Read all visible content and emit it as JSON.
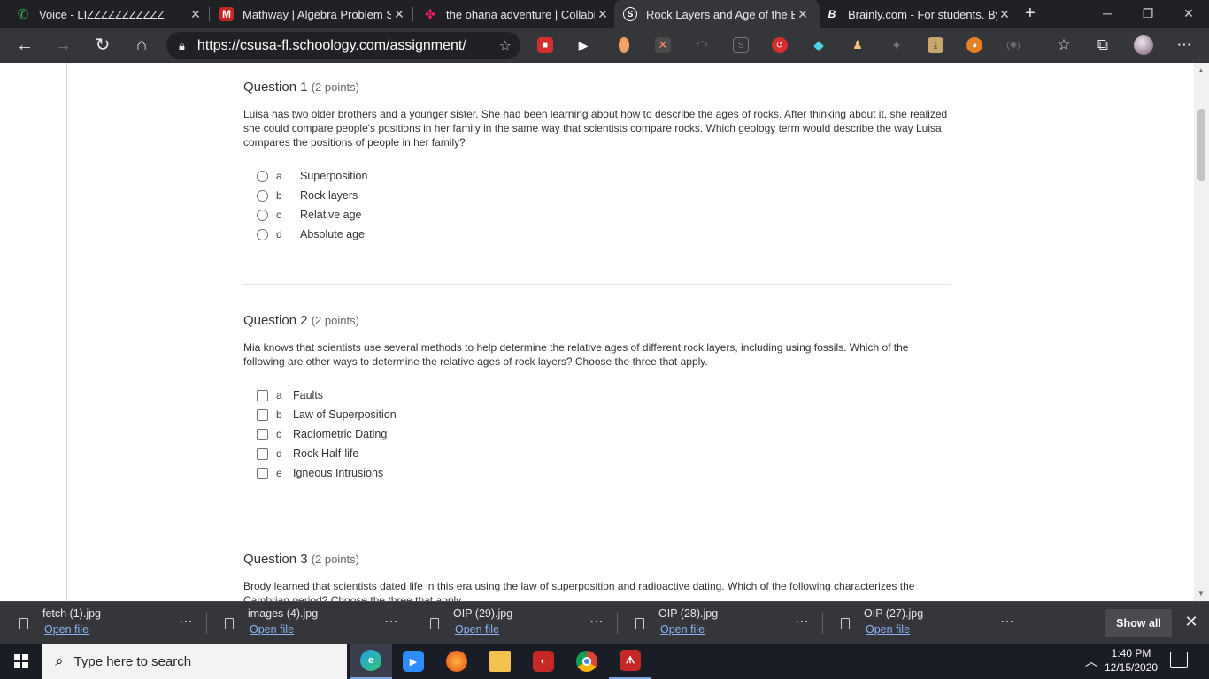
{
  "browser": {
    "tabs": [
      {
        "title": "Voice - LIZZZZZZZZZZZ",
        "icon": "phone-icon",
        "color": "#34a853"
      },
      {
        "title": "Mathway | Algebra Problem Solver",
        "icon": "mathway-icon",
        "color": "#c62828"
      },
      {
        "title": "the ohana adventure | Collabify",
        "icon": "collabify-icon",
        "color": "#e91e63"
      },
      {
        "title": "Rock Layers and Age of the Earth",
        "icon": "schoology-icon",
        "color": "#ffffff",
        "active": true
      },
      {
        "title": "Brainly.com - For students. By students.",
        "icon": "brainly-icon",
        "color": "#ffffff"
      }
    ],
    "new_tab": "+",
    "url": "https://csusa-fl.schoology.com/assignment/"
  },
  "questions": [
    {
      "label": "Question 1",
      "points": "(2 points)",
      "text": "Luisa has two older brothers and a younger sister. She had been learning about how to describe the ages of rocks. After thinking about it, she realized she could compare people's positions in her family in the same way that scientists compare rocks. Which geology term would describe the way Luisa compares the positions of people in her family?",
      "type": "radio",
      "options": [
        {
          "letter": "a",
          "text": "Superposition"
        },
        {
          "letter": "b",
          "text": "Rock layers"
        },
        {
          "letter": "c",
          "text": "Relative age"
        },
        {
          "letter": "d",
          "text": "Absolute age"
        }
      ]
    },
    {
      "label": "Question 2",
      "points": "(2 points)",
      "text": "Mia knows that scientists use several methods to help determine the relative ages of different rock layers, including using fossils. Which of the following are other ways to determine the relative ages of rock layers? Choose the three that apply.",
      "type": "checkbox",
      "options": [
        {
          "letter": "a",
          "text": "Faults"
        },
        {
          "letter": "b",
          "text": "Law of Superposition"
        },
        {
          "letter": "c",
          "text": "Radiometric Dating"
        },
        {
          "letter": "d",
          "text": "Rock Half-life"
        },
        {
          "letter": "e",
          "text": "Igneous Intrusions"
        }
      ]
    },
    {
      "label": "Question 3",
      "points": "(2 points)",
      "text": "Brody learned that scientists dated life in this era using the law of superposition and radioactive dating. Which of the following characterizes the Cambrian period? Choose the three that apply."
    }
  ],
  "downloads": {
    "items": [
      {
        "name": "fetch (1).jpg",
        "action": "Open file"
      },
      {
        "name": "images (4).jpg",
        "action": "Open file"
      },
      {
        "name": "OIP (29).jpg",
        "action": "Open file"
      },
      {
        "name": "OIP (28).jpg",
        "action": "Open file"
      },
      {
        "name": "OIP (27).jpg",
        "action": "Open file"
      }
    ],
    "show_all": "Show all"
  },
  "taskbar": {
    "search_placeholder": "Type here to search",
    "time": "1:40 PM",
    "date": "12/15/2020"
  }
}
